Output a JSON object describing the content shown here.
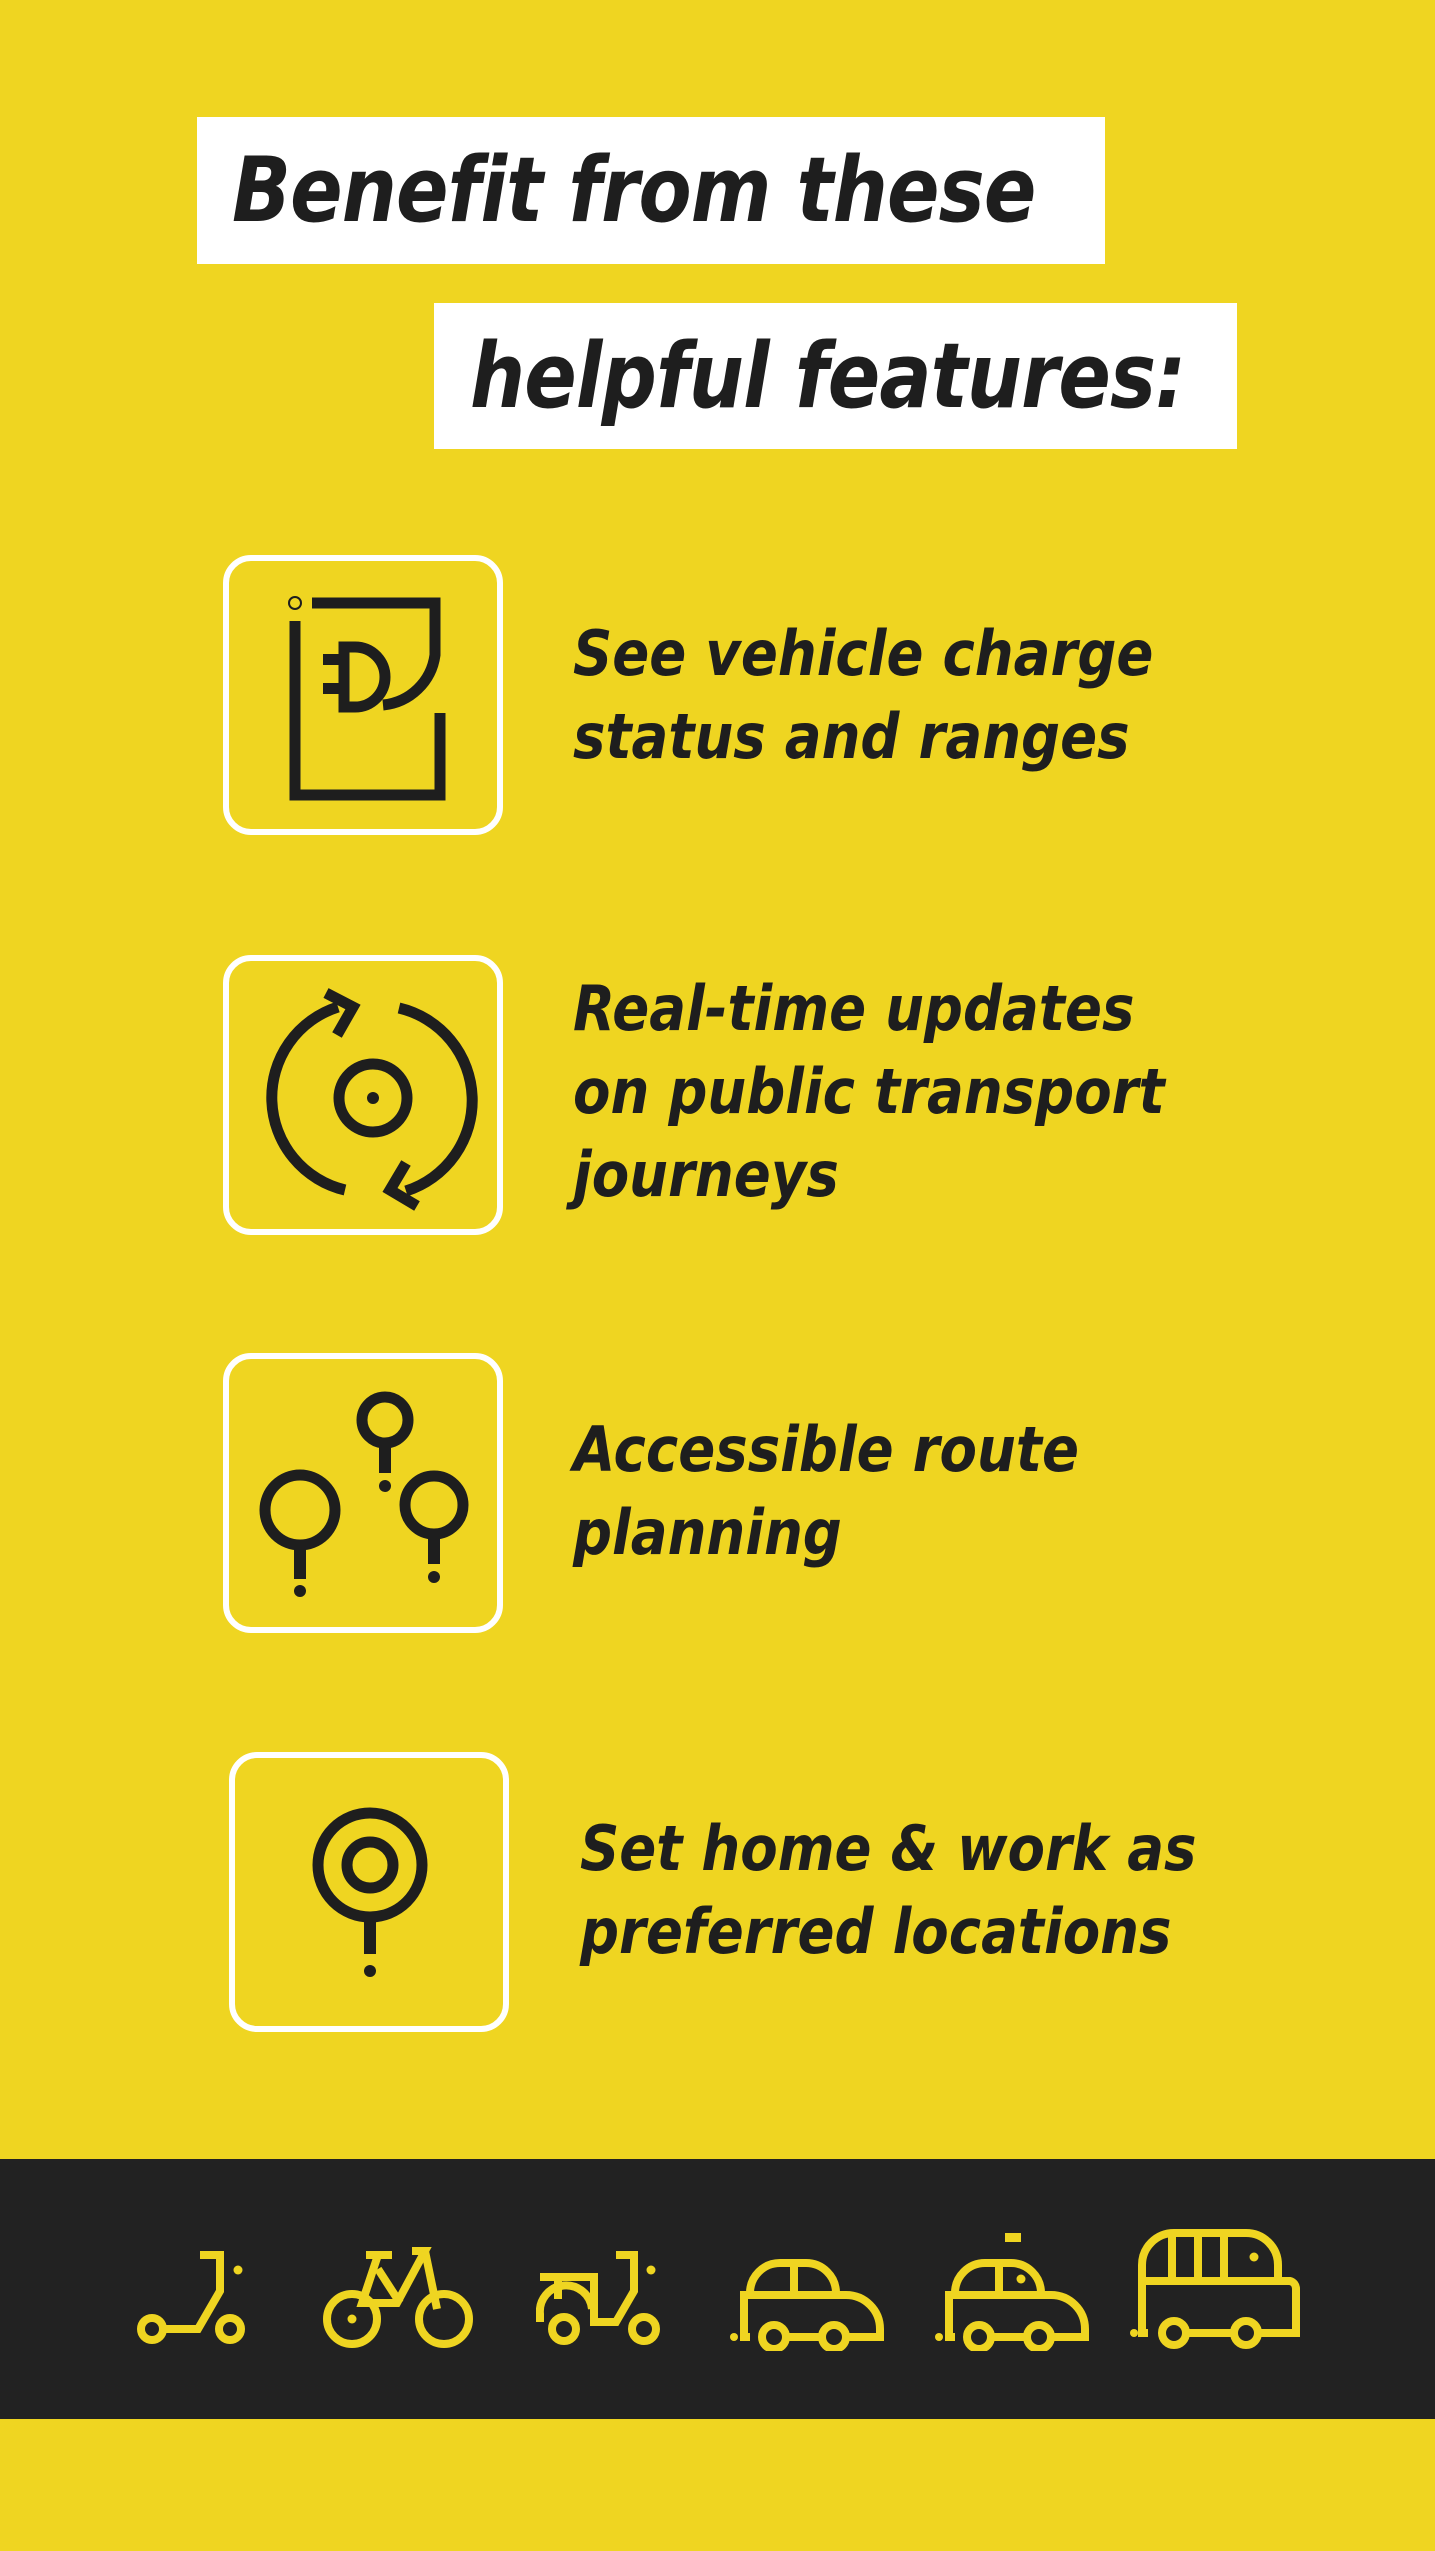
{
  "heading": {
    "line1": "Benefit from these",
    "line2": "helpful features:"
  },
  "features": [
    {
      "icon": "ev-charge-icon",
      "lines": [
        "See vehicle charge",
        "status and ranges"
      ]
    },
    {
      "icon": "realtime-refresh-icon",
      "lines": [
        "Real-time updates",
        "on public transport",
        "journeys"
      ]
    },
    {
      "icon": "route-pins-icon",
      "lines": [
        "Accessible route",
        "planning"
      ]
    },
    {
      "icon": "preferred-location-pin-icon",
      "lines": [
        "Set home & work as",
        "preferred locations"
      ]
    }
  ],
  "vehicles": [
    "e-scooter-icon",
    "bicycle-icon",
    "moped-icon",
    "car-icon",
    "taxi-icon",
    "bus-icon"
  ],
  "colors": {
    "background": "#EFD521",
    "text": "#1E1E1E",
    "heading_box": "#FFFFFF",
    "band": "#222222",
    "vehicle_icon": "#EFD521"
  }
}
